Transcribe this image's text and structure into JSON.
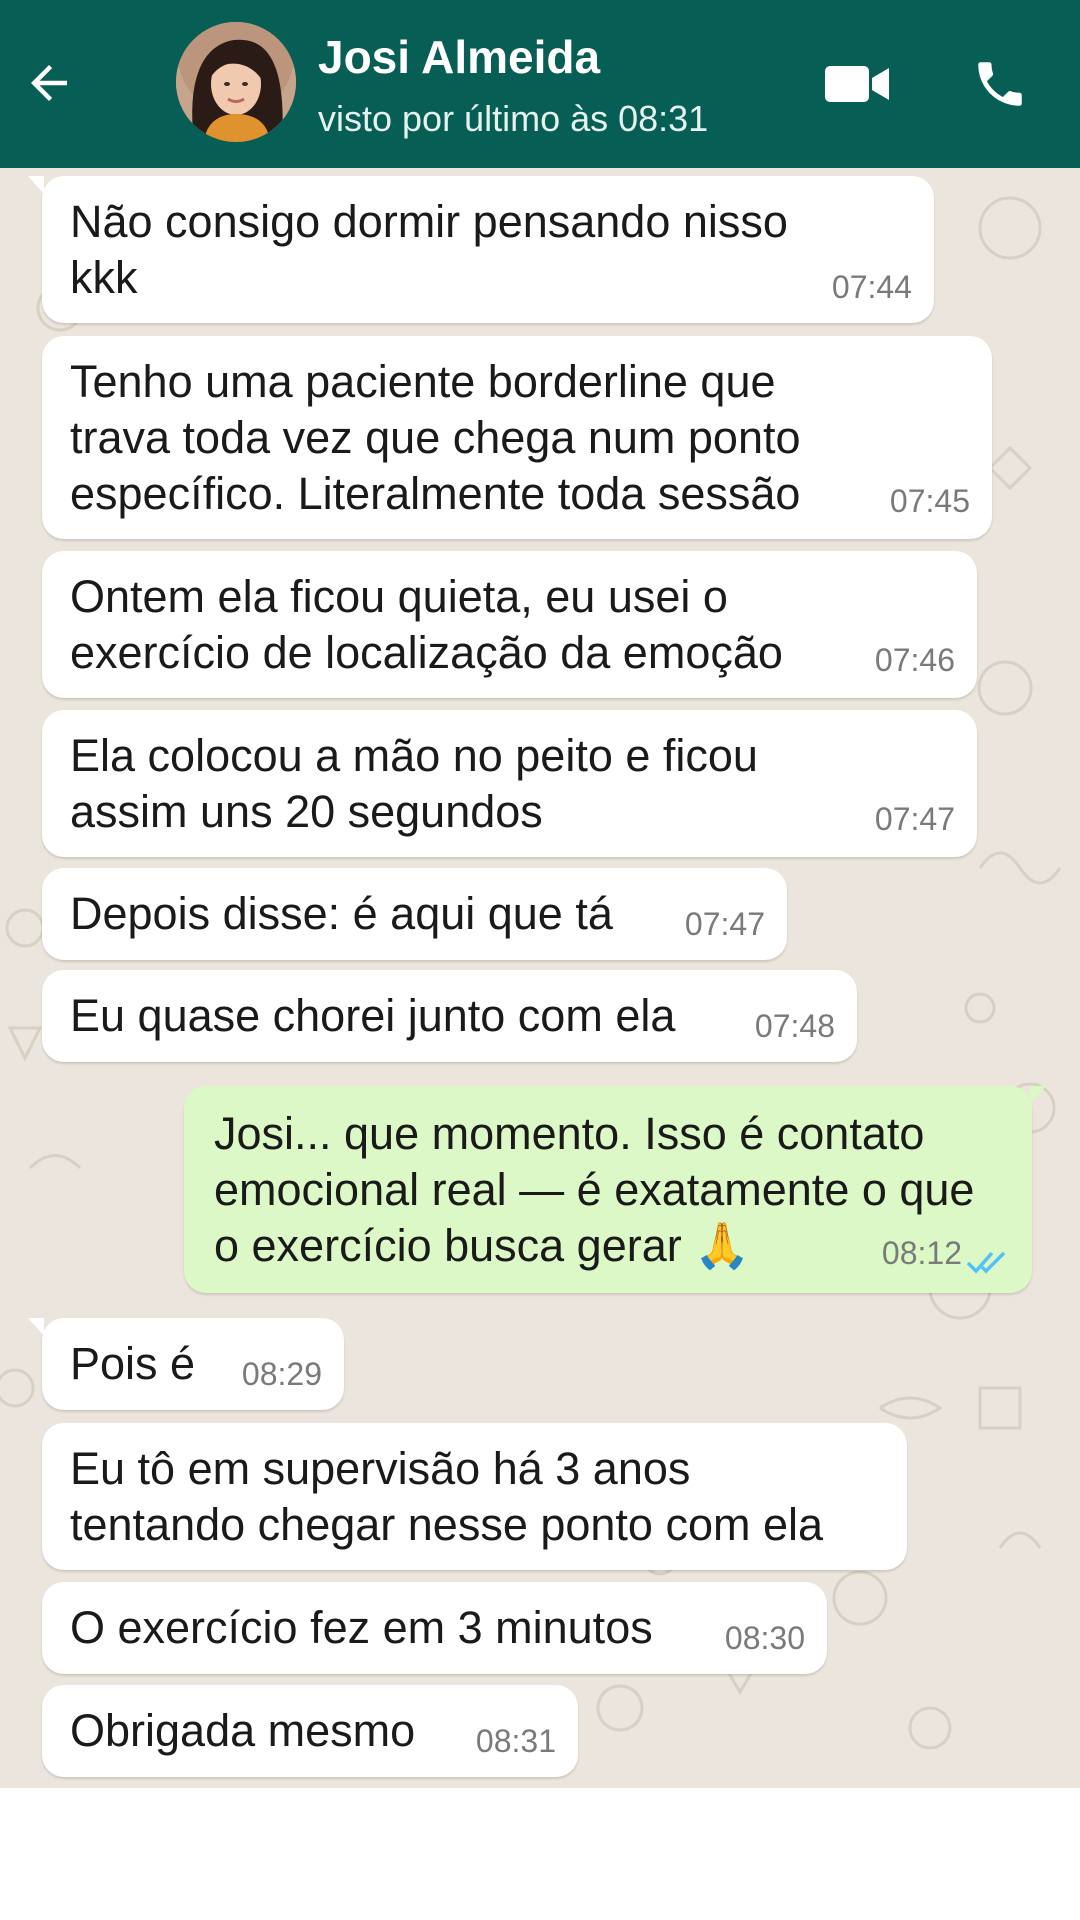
{
  "header": {
    "contact_name": "Josi Almeida",
    "last_seen": "visto por último às 08:31",
    "icons": [
      "back-arrow-icon",
      "video-call-icon",
      "phone-icon"
    ],
    "color": "#075e54"
  },
  "chat": {
    "wallpaper_color": "#ece5dd",
    "incoming_color": "#ffffff",
    "outgoing_color": "#dcf8c6",
    "read_receipt_color": "#4fc3f7",
    "messages": [
      {
        "direction": "in",
        "lines": [
          "Não consigo dormir pensando nisso",
          "kkk"
        ],
        "time": "07:44"
      },
      {
        "direction": "in",
        "lines": [
          "Tenho uma paciente borderline que",
          "trava toda vez que chega num ponto",
          "específico. Literalmente toda sessão"
        ],
        "time": "07:45"
      },
      {
        "direction": "in",
        "lines": [
          "Ontem ela ficou quieta, eu usei o",
          "exercício de localização da emoção"
        ],
        "time": "07:46"
      },
      {
        "direction": "in",
        "lines": [
          "Ela colocou a mão no peito e ficou",
          "assim uns 20 segundos"
        ],
        "time": "07:47"
      },
      {
        "direction": "in",
        "lines": [
          "Depois disse: é aqui que tá"
        ],
        "time": "07:47"
      },
      {
        "direction": "in",
        "lines": [
          "Eu quase chorei junto com ela"
        ],
        "time": "07:48"
      },
      {
        "direction": "out",
        "lines": [
          "Josi... que momento. Isso é contato",
          "emocional real — é exatamente o que",
          "o exercício busca gerar 🙏"
        ],
        "time": "08:12",
        "status": "read"
      },
      {
        "direction": "in",
        "lines": [
          "Pois é"
        ],
        "time": "08:29"
      },
      {
        "direction": "in",
        "lines": [
          "Eu tô em supervisão há 3 anos",
          "tentando chegar nesse ponto com ela"
        ],
        "time": ""
      },
      {
        "direction": "in",
        "lines": [
          "O exercício fez em 3 minutos"
        ],
        "time": "08:30"
      },
      {
        "direction": "in",
        "lines": [
          "Obrigada mesmo"
        ],
        "time": "08:31"
      }
    ]
  }
}
